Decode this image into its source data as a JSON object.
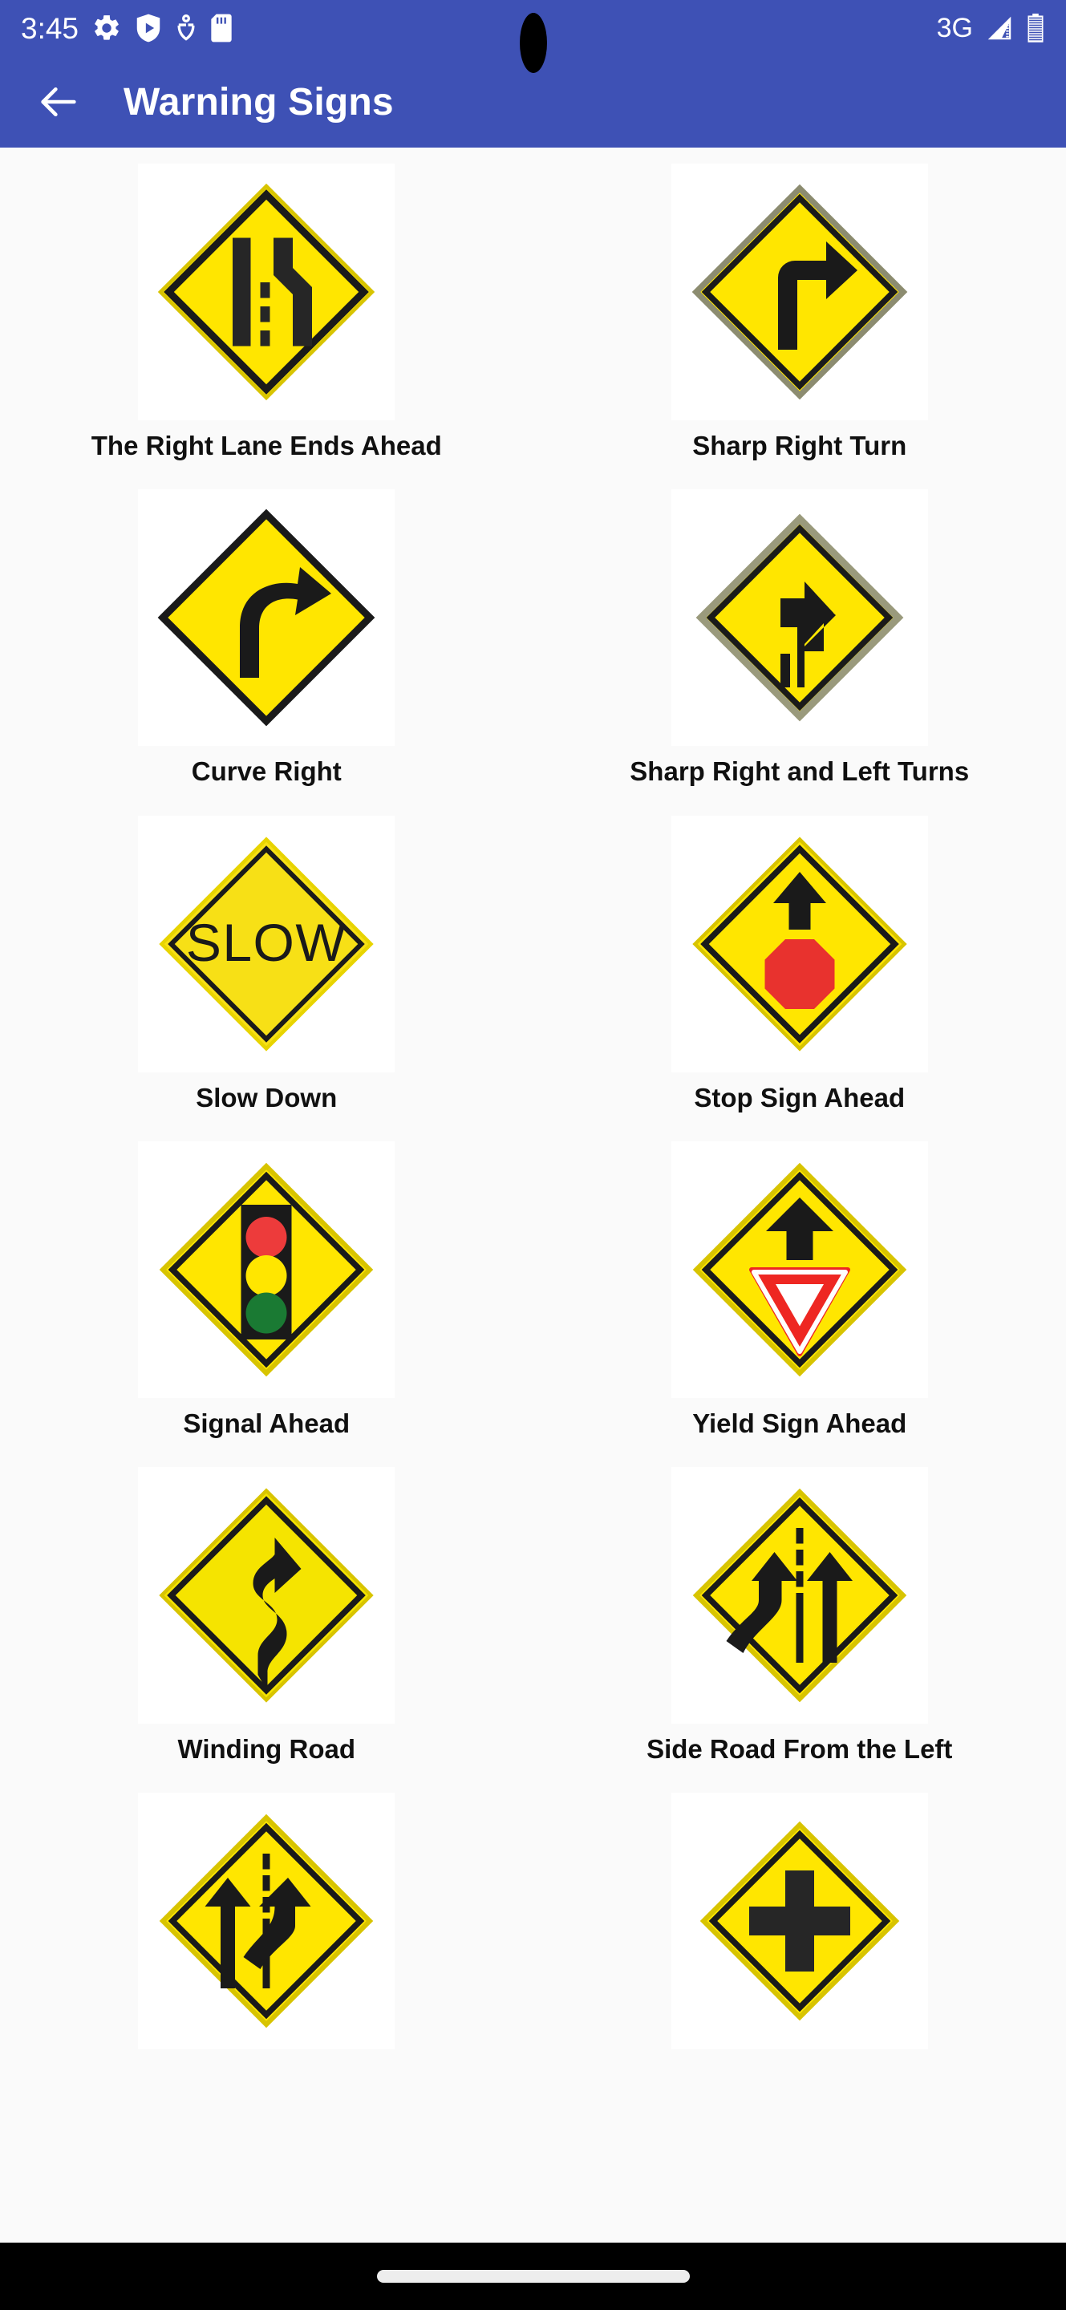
{
  "theme": {
    "primary": "#3E51B5",
    "sign_yellow": "#FFE600",
    "sign_black": "#1A1A1A",
    "page_bg": "#FAFAFA",
    "nav_bg": "#000000",
    "red": "#ED3B3B",
    "green": "#1A7A33",
    "yield_red": "#EE2722"
  },
  "status_bar": {
    "time": "3:45",
    "network_label": "3G",
    "icons": [
      "gear-icon",
      "play-shield-icon",
      "downloads-icon",
      "sd-card-icon"
    ],
    "right_icons": [
      "signal-bars-icon",
      "battery-icon"
    ]
  },
  "app_bar": {
    "back_label": "Back",
    "title": "Warning Signs"
  },
  "signs": [
    {
      "label": "The Right Lane Ends Ahead",
      "icon": "right-lane-ends-sign"
    },
    {
      "label": "Sharp Right Turn",
      "icon": "sharp-right-turn-sign"
    },
    {
      "label": "Curve Right",
      "icon": "curve-right-sign"
    },
    {
      "label": "Sharp Right and Left Turns",
      "icon": "sharp-right-left-turns-sign"
    },
    {
      "label": "Slow Down",
      "icon": "slow-sign",
      "sign_text": "SLOW"
    },
    {
      "label": "Stop Sign Ahead",
      "icon": "stop-sign-ahead-sign"
    },
    {
      "label": "Signal Ahead",
      "icon": "signal-ahead-sign"
    },
    {
      "label": "Yield Sign Ahead",
      "icon": "yield-sign-ahead-sign"
    },
    {
      "label": "Winding Road",
      "icon": "winding-road-sign"
    },
    {
      "label": "Side Road From the Left",
      "icon": "side-road-from-left-sign"
    },
    {
      "label": "",
      "icon": "lane-merge-sign"
    },
    {
      "label": "",
      "icon": "crossroad-sign"
    }
  ],
  "nav_bar": {
    "home_indicator": "home-indicator"
  }
}
